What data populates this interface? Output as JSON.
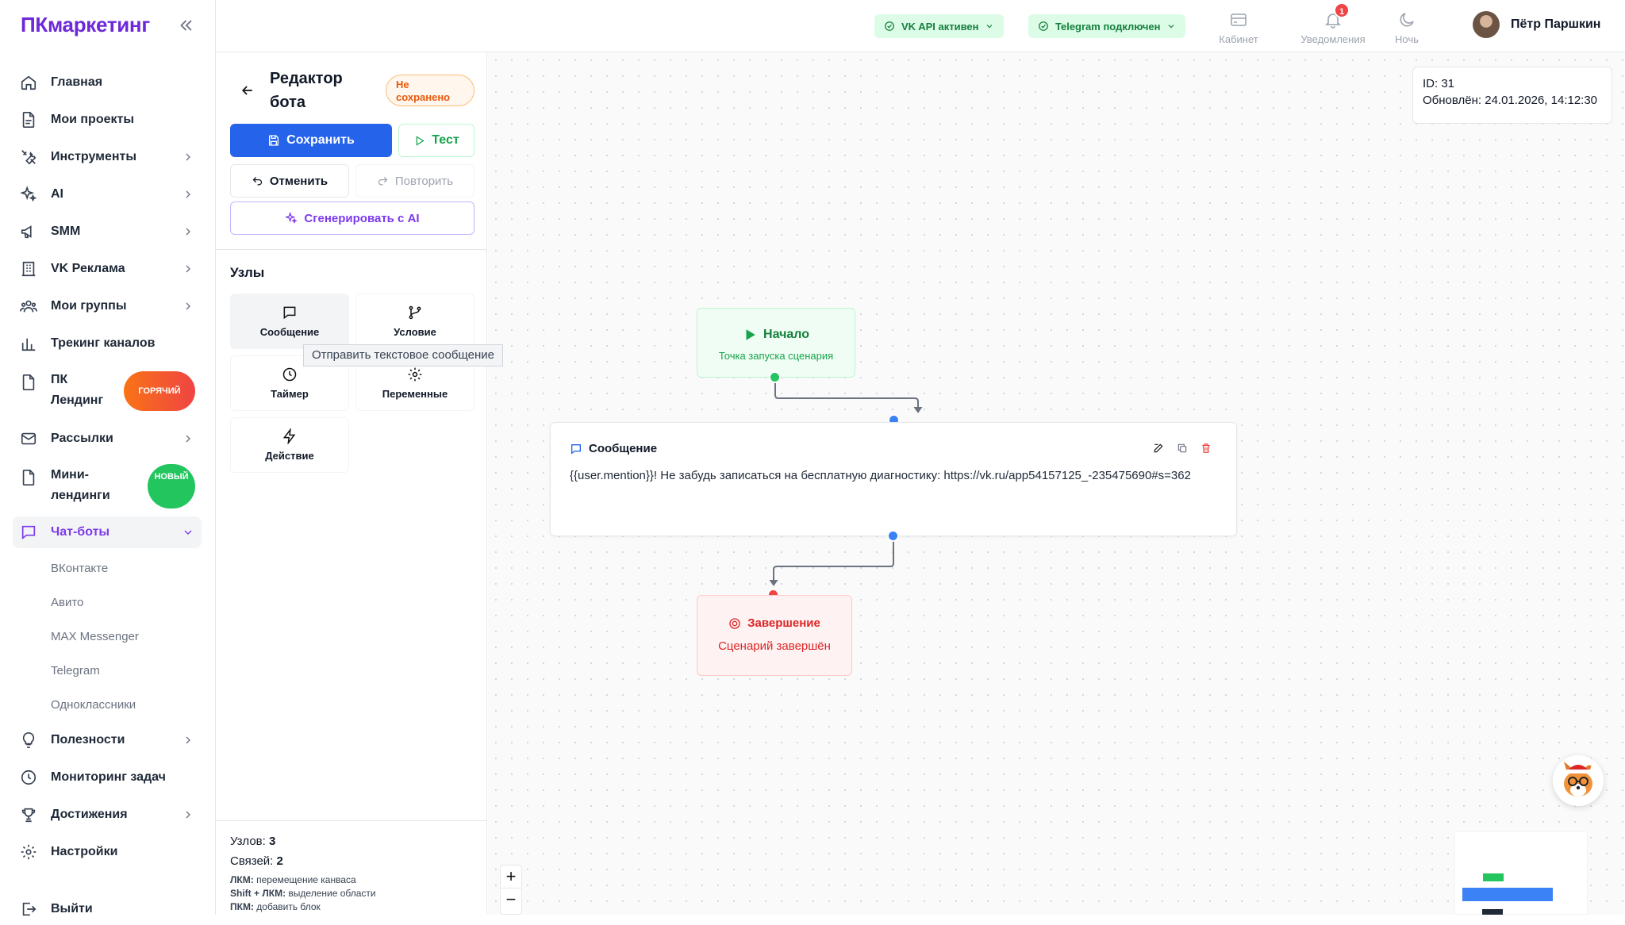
{
  "app": {
    "logo": "ПКмаркетинг"
  },
  "sidebar": {
    "items": [
      {
        "label": "Главная",
        "icon": "home-icon"
      },
      {
        "label": "Мои проекты",
        "icon": "document-icon"
      },
      {
        "label": "Инструменты",
        "icon": "tools-icon"
      },
      {
        "label": "AI",
        "icon": "sparkles-icon"
      },
      {
        "label": "SMM",
        "icon": "megaphone-icon"
      },
      {
        "label": "VK Реклама",
        "icon": "building-icon"
      },
      {
        "label": "Мои группы",
        "icon": "users-icon"
      },
      {
        "label": "Трекинг каналов",
        "icon": "bar-chart-icon"
      },
      {
        "label": "ПК Лендинг",
        "icon": "document-icon"
      },
      {
        "label": "Рассылки",
        "icon": "mail-icon"
      },
      {
        "label": "Мини-лендинги",
        "icon": "document-icon"
      },
      {
        "label": "Чат-боты",
        "icon": "chat-icon"
      },
      {
        "label": "Полезности",
        "icon": "lightbulb-icon"
      },
      {
        "label": "Мониторинг задач",
        "icon": "clock-icon"
      },
      {
        "label": "Достижения",
        "icon": "trophy-icon"
      },
      {
        "label": "Настройки",
        "icon": "gear-icon"
      },
      {
        "label": "Выйти",
        "icon": "logout-icon"
      }
    ],
    "badges": {
      "hot": "ГОРЯЧИЙ",
      "new": "НОВЫЙ"
    },
    "chatbots_sub": [
      "ВКонтакте",
      "Авито",
      "MAX Messenger",
      "Telegram",
      "Одноклассники"
    ]
  },
  "topbar": {
    "vk_status": "VK API активен",
    "tg_status": "Telegram подключен",
    "cabinet": "Кабинет",
    "notifications": "Уведомления",
    "notifications_count": "1",
    "night": "Ночь",
    "user_name": "Пётр Паршкин"
  },
  "editor": {
    "title": "Редактор бота",
    "unsaved": "Не сохранено",
    "save": "Сохранить",
    "test": "Тест",
    "undo": "Отменить",
    "redo": "Повторить",
    "generate_ai": "Сгенерировать с AI",
    "nodes_heading": "Узлы",
    "node_types": [
      {
        "label": "Сообщение",
        "icon": "message-icon"
      },
      {
        "label": "Условие",
        "icon": "branch-icon"
      },
      {
        "label": "Таймер",
        "icon": "clock-icon"
      },
      {
        "label": "Переменные",
        "icon": "gear-icon"
      },
      {
        "label": "Действие",
        "icon": "lightning-icon"
      }
    ],
    "tooltip": "Отправить текстовое сообщение",
    "stats": {
      "nodes_label": "Узлов:",
      "nodes": "3",
      "links_label": "Связей:",
      "links": "2"
    },
    "hints": [
      {
        "key": "ЛКМ:",
        "text": "перемещение канваса"
      },
      {
        "key": "Shift + ЛКМ:",
        "text": "выделение области"
      },
      {
        "key": "ПКМ:",
        "text": "добавить блок"
      }
    ]
  },
  "canvas": {
    "id_line": "ID: 31",
    "updated_line": "Обновлён: 24.01.2026, 14:12:30",
    "start": {
      "title": "Начало",
      "subtitle": "Точка запуска сценария"
    },
    "message": {
      "title": "Сообщение",
      "text": "{{user.mention}}! Не забудь записаться на бесплатную диагностику: https://vk.ru/app54157125_-235475690#s=362"
    },
    "end": {
      "title": "Завершение",
      "subtitle": "Сценарий завершён"
    },
    "zoom_in": "+",
    "zoom_out": "−"
  },
  "colors": {
    "brand": "#6d28d9",
    "primary": "#2563eb",
    "success": "#16a34a",
    "danger": "#dc2626",
    "ai": "#7c3aed"
  }
}
